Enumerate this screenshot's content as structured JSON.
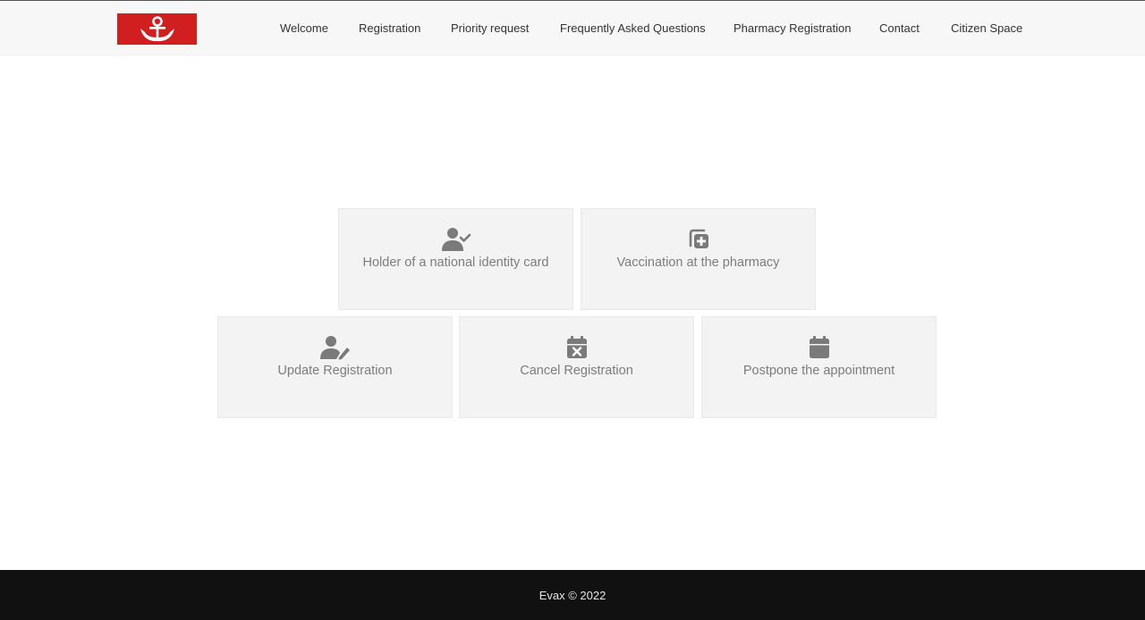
{
  "header": {
    "logo_icon": "anchor-logo-icon",
    "logo_color": "#d11f1f",
    "nav": [
      {
        "label": "Welcome"
      },
      {
        "label": "Registration"
      },
      {
        "label": "Priority request"
      },
      {
        "label": "Frequently Asked Questions"
      },
      {
        "label": "Pharmacy Registration"
      },
      {
        "label": "Contact"
      },
      {
        "label": "Citizen Space"
      }
    ]
  },
  "cards": [
    {
      "icon": "user-check-icon",
      "label": "Holder of a national identity card"
    },
    {
      "icon": "medical-plus-icon",
      "label": "Vaccination at the pharmacy"
    },
    {
      "icon": "user-edit-icon",
      "label": "Update Registration"
    },
    {
      "icon": "calendar-cancel-icon",
      "label": "Cancel Registration"
    },
    {
      "icon": "calendar-icon",
      "label": "Postpone the appointment"
    }
  ],
  "footer": {
    "text": "Evax © 2022"
  },
  "colors": {
    "card_bg": "#f3f3f3",
    "icon_gray": "#7a7a7a",
    "footer_bg": "#111111"
  }
}
